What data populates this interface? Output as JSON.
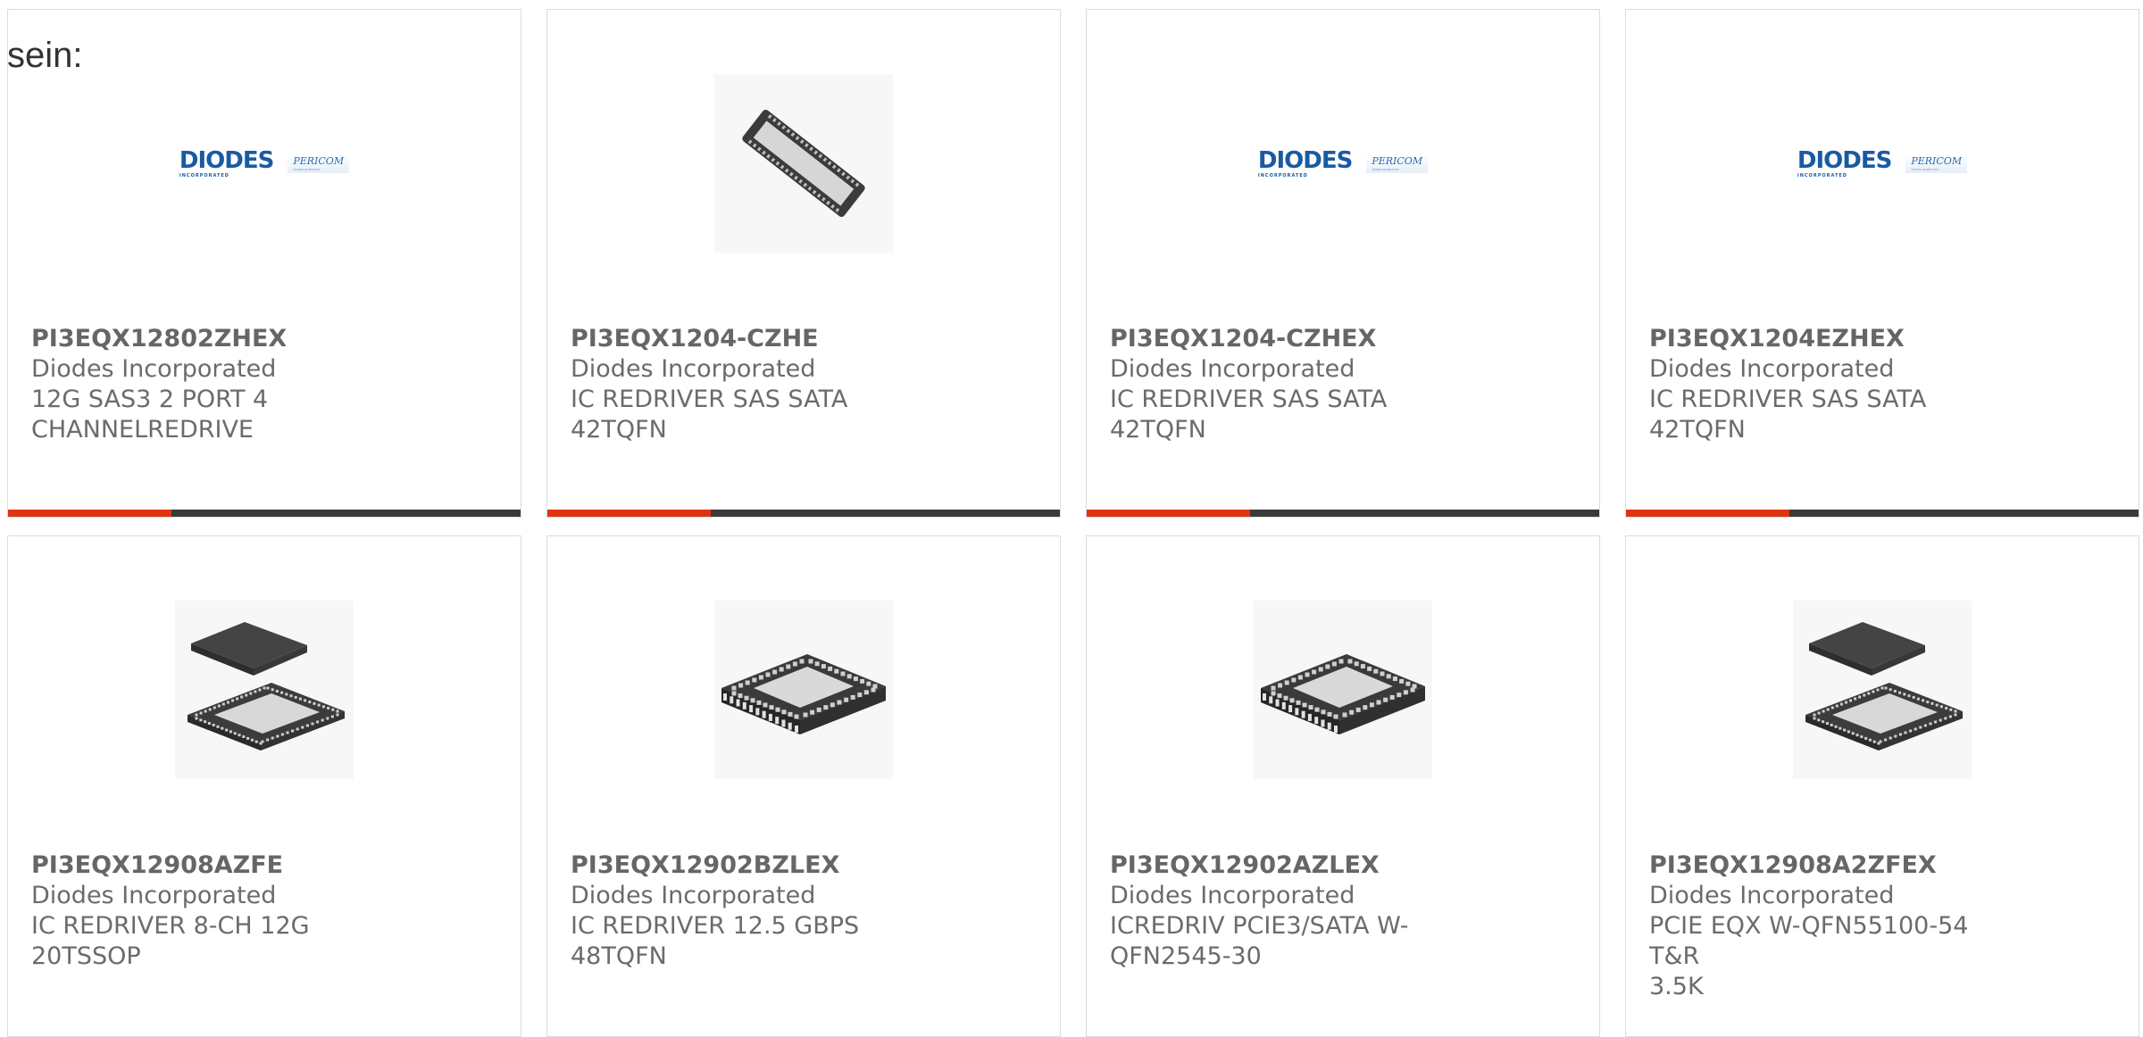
{
  "intro": {
    "text": "sein:"
  },
  "products": [
    {
      "part_number": "PI3EQX12802ZHEX",
      "manufacturer": "Diodes Incorporated",
      "description_lines": [
        "12G SAS3 2 PORT 4",
        "CHANNELREDRIVE"
      ],
      "image": "diodes-pericom-logo"
    },
    {
      "part_number": "PI3EQX1204-CZHE",
      "manufacturer": "Diodes Incorporated",
      "description_lines": [
        "IC REDRIVER SAS SATA 42TQFN"
      ],
      "image": "ic-chip-tqfn-diagonal"
    },
    {
      "part_number": "PI3EQX1204-CZHEX",
      "manufacturer": "Diodes Incorporated",
      "description_lines": [
        "IC REDRIVER SAS SATA 42TQFN"
      ],
      "image": "diodes-pericom-logo"
    },
    {
      "part_number": "PI3EQX1204EZHEX",
      "manufacturer": "Diodes Incorporated",
      "description_lines": [
        "IC REDRIVER SAS SATA 42TQFN"
      ],
      "image": "diodes-pericom-logo"
    },
    {
      "part_number": "PI3EQX12908AZFE",
      "manufacturer": "Diodes Incorporated",
      "description_lines": [
        "IC REDRIVER 8-CH 12G 20TSSOP"
      ],
      "image": "ic-chip-qfn-with-lid"
    },
    {
      "part_number": "PI3EQX12902BZLEX",
      "manufacturer": "Diodes Incorporated",
      "description_lines": [
        "IC REDRIVER 12.5 GBPS 48TQFN"
      ],
      "image": "ic-chip-qfn"
    },
    {
      "part_number": "PI3EQX12902AZLEX",
      "manufacturer": "Diodes Incorporated",
      "description_lines": [
        "ICREDRIV PCIE3/SATA W-",
        "QFN2545-30"
      ],
      "image": "ic-chip-qfn"
    },
    {
      "part_number": "PI3EQX12908A2ZFEX",
      "manufacturer": "Diodes Incorporated",
      "description_lines": [
        "PCIE EQX W-QFN55100-54 T&R",
        "3.5K"
      ],
      "image": "ic-chip-qfn-with-lid"
    }
  ],
  "logo": {
    "brand": "DIODES",
    "brand_tag": "INCORPORATED",
    "partner": "PERICOM",
    "partner_sub": "Semiconductor"
  },
  "colors": {
    "accent_bar": "#e0340e",
    "bar_dark": "#3a3a3a",
    "card_border": "#dcdcdc",
    "text": "#6b6b6b"
  }
}
